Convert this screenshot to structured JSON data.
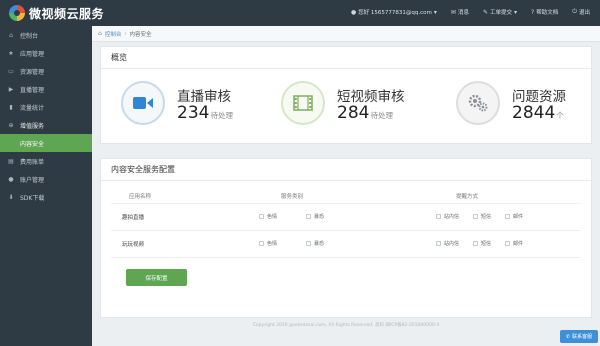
{
  "brand": {
    "name": "微视频云服务"
  },
  "topnav": {
    "user": "您好 1565777831@qq.com",
    "messages": "消息",
    "ticket": "工单提交",
    "help": "帮助文档",
    "logout": "退出"
  },
  "sidebar": {
    "items": [
      {
        "label": "控制台",
        "icon": "home-icon"
      },
      {
        "label": "应用管理",
        "icon": "star-icon"
      },
      {
        "label": "资源管理",
        "icon": "folder-icon"
      },
      {
        "label": "直播管理",
        "icon": "video-icon"
      },
      {
        "label": "流量统计",
        "icon": "chart-icon"
      },
      {
        "label": "增值服务",
        "icon": "plus-icon"
      },
      {
        "label": "内容安全",
        "icon": "shield-icon"
      },
      {
        "label": "费用账单",
        "icon": "bill-icon"
      },
      {
        "label": "账户管理",
        "icon": "user-icon"
      },
      {
        "label": "SDK下载",
        "icon": "download-icon"
      }
    ]
  },
  "breadcrumb": {
    "home": "控制台",
    "current": "内容安全"
  },
  "overview": {
    "title": "概览",
    "stats": [
      {
        "title": "直播审核",
        "value": "234",
        "unit": "待处理",
        "icon": "video-camera-icon"
      },
      {
        "title": "短视频审核",
        "value": "284",
        "unit": "待处理",
        "icon": "film-icon"
      },
      {
        "title": "问题资源",
        "value": "2844",
        "unit": "个",
        "icon": "gears-icon"
      }
    ]
  },
  "config": {
    "title": "内容安全服务配置",
    "columns": [
      "应用名称",
      "服务类别",
      "提醒方式"
    ],
    "rows": [
      {
        "name": "趣拍直播",
        "services": [
          "色情",
          "暴恐"
        ],
        "notify": [
          "站内信",
          "短信",
          "邮件"
        ]
      },
      {
        "name": "玩玩视频",
        "services": [
          "色情",
          "暴恐"
        ],
        "notify": [
          "站内信",
          "短信",
          "邮件"
        ]
      }
    ],
    "save_label": "保存配置"
  },
  "footer": {
    "text": "Copyright 2016 gaokedesai.com, All Rights Reserved. 高科 闽ICP备82-201000000-4"
  },
  "support": {
    "label": "联系客服"
  },
  "colors": {
    "accent": "#5fa653",
    "dark": "#2f3b44",
    "blue": "#3d8fd8"
  }
}
